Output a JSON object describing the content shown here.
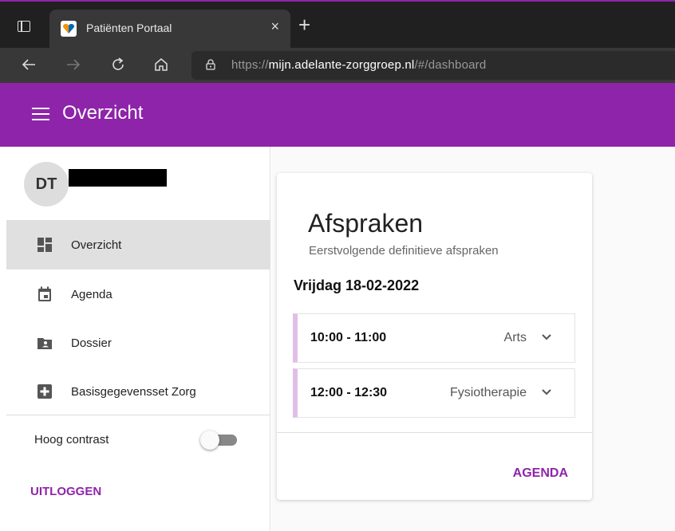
{
  "browser": {
    "tab_title": "Patiënten Portaal",
    "tab_close": "×",
    "new_tab": "+",
    "url_prefix": "https://",
    "url_host": "mijn.adelante-zorggroep.nl",
    "url_path": "/#/dashboard"
  },
  "header": {
    "title": "Overzicht",
    "color": "#8e24aa"
  },
  "sidebar": {
    "avatar_initials": "DT",
    "items": [
      {
        "label": "Overzicht",
        "icon": "dashboard-icon",
        "active": true
      },
      {
        "label": "Agenda",
        "icon": "calendar-icon",
        "active": false
      },
      {
        "label": "Dossier",
        "icon": "folder-person-icon",
        "active": false
      },
      {
        "label": "Basisgegevensset Zorg",
        "icon": "medical-plus-icon",
        "active": false
      }
    ],
    "contrast_label": "Hoog contrast",
    "contrast_on": false,
    "logout_label": "UITLOGGEN"
  },
  "card": {
    "title": "Afspraken",
    "subtitle": "Eerstvolgende definitieve afspraken",
    "date": "Vrijdag 18-02-2022",
    "appointments": [
      {
        "time": "10:00 - 11:00",
        "type": "Arts"
      },
      {
        "time": "12:00 - 12:30",
        "type": "Fysiotherapie"
      }
    ],
    "action_label": "AGENDA"
  }
}
